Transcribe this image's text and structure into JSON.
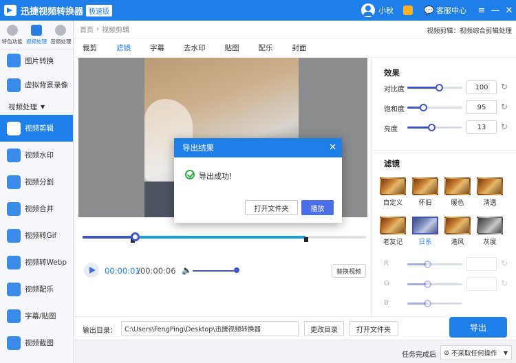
{
  "titlebar": {
    "app_title": "迅捷视频转换器",
    "edition": "极速版",
    "username": "小秋",
    "service": "客服中心",
    "icons": [
      "avatar-icon",
      "vip-icon",
      "chat-icon",
      "menu-icon",
      "minimize-icon",
      "close-icon"
    ]
  },
  "sidebar": {
    "top_tabs": [
      {
        "label": "特色功能"
      },
      {
        "label": "视频处理"
      },
      {
        "label": "音频处理"
      }
    ],
    "pre_items": [
      {
        "label": "图片转换"
      },
      {
        "label": "虚拟背景录像"
      }
    ],
    "section": "视频处理",
    "items": [
      {
        "label": "视频剪辑"
      },
      {
        "label": "视频水印"
      },
      {
        "label": "视频分割"
      },
      {
        "label": "视频合并"
      },
      {
        "label": "视频转Gif"
      },
      {
        "label": "视频转Webp"
      },
      {
        "label": "视频配乐"
      },
      {
        "label": "字幕/贴图"
      },
      {
        "label": "视频截图"
      }
    ]
  },
  "breadcrumb": {
    "home": "首页",
    "current": "视频剪辑",
    "right": "视频剪辑：视频综合剪辑处理"
  },
  "tabs": [
    {
      "label": "裁剪"
    },
    {
      "label": "滤镜"
    },
    {
      "label": "字幕"
    },
    {
      "label": "去水印"
    },
    {
      "label": "贴图"
    },
    {
      "label": "配乐"
    },
    {
      "label": "封面"
    }
  ],
  "player": {
    "time_current": "00:00:01",
    "time_total": "/00:00:06",
    "replace_label": "替换视频"
  },
  "effects": {
    "title": "效果",
    "sliders": [
      {
        "label": "对比度",
        "value": "100",
        "fraction": 0.58
      },
      {
        "label": "饱和度",
        "value": "95",
        "fraction": 0.29
      },
      {
        "label": "亮度",
        "value": "13",
        "fraction": 0.44
      }
    ]
  },
  "filters": {
    "title": "滤镜",
    "items": [
      {
        "label": "自定义"
      },
      {
        "label": "怀旧"
      },
      {
        "label": "暖色"
      },
      {
        "label": "清透"
      },
      {
        "label": "老友记"
      },
      {
        "label": "日系"
      },
      {
        "label": "港风"
      },
      {
        "label": "灰度"
      }
    ],
    "rgb": [
      {
        "label": "R",
        "fraction": 0.36
      },
      {
        "label": "G",
        "fraction": 0.36
      },
      {
        "label": "B",
        "fraction": 0.36
      }
    ]
  },
  "output": {
    "label": "输出目录：",
    "path": "C:\\Users\\FengPing\\Desktop\\迅捷视频转换器",
    "change_dir": "更改目录",
    "open_folder": "打开文件夹"
  },
  "export_label": "导出",
  "status": {
    "label": "任务完成后",
    "option": "不采取任何操作"
  },
  "dialog": {
    "title": "导出结果",
    "message": "导出成功!",
    "open_folder": "打开文件夹",
    "play": "播放"
  }
}
